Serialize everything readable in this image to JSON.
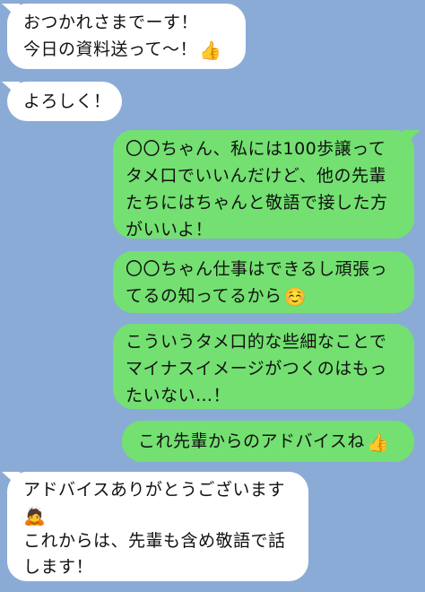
{
  "messages": [
    {
      "side": "in",
      "lines": [
        "おつかれさまでーす！",
        "今日の資料送って〜！"
      ],
      "emoji": "👍"
    },
    {
      "side": "in",
      "lines": [
        "よろしく！"
      ]
    },
    {
      "side": "out",
      "lines": [
        "〇〇ちゃん、私には100歩譲って",
        "タメ口でいいんだけど、他の先輩",
        "たちにはちゃんと敬語で接した方",
        "がいいよ！"
      ]
    },
    {
      "side": "out",
      "lines": [
        "〇〇ちゃん仕事はできるし頑張っ",
        "てるの知ってるから"
      ],
      "emoji": "☺️"
    },
    {
      "side": "out",
      "lines": [
        "こういうタメ口的な些細なことで",
        "マイナスイメージがつくのはもっ",
        "たいない…！"
      ]
    },
    {
      "side": "out",
      "lines": [
        "これ先輩からのアドバイスね"
      ],
      "emoji": "👍"
    },
    {
      "side": "in",
      "lines": [
        "アドバイスありがとうございます",
        "これからは、先輩も含め敬語で話",
        "します！"
      ],
      "emoji": "🙇"
    }
  ],
  "colors": {
    "background": "#8aabd6",
    "incoming_bubble": "#ffffff",
    "outgoing_bubble": "#73e071"
  }
}
